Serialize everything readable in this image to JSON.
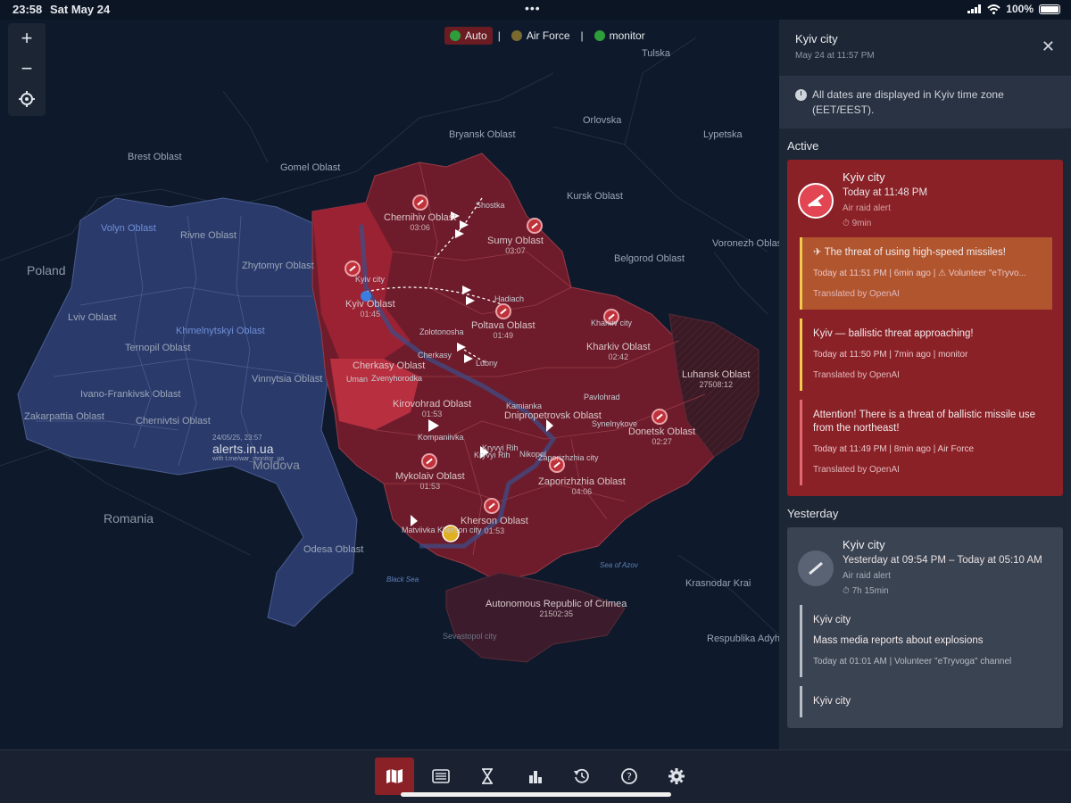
{
  "status": {
    "time": "23:58",
    "date": "Sat May 24",
    "battery": "100%"
  },
  "map": {
    "sources": [
      {
        "label": "Auto",
        "active": true,
        "color": "#2e9e3a"
      },
      {
        "label": "Air Force",
        "active": false,
        "color": "#7a6a2f"
      },
      {
        "label": "monitor",
        "active": false,
        "color": "#2e9e3a"
      }
    ],
    "countries": {
      "poland": "Poland",
      "moldova": "Moldova",
      "romania": "Romania"
    },
    "regions": {
      "brest": "Brest Oblast",
      "gomel": "Gomel Oblast",
      "bryansk": "Bryansk Oblast",
      "orlovska": "Orlovska",
      "kursk": "Kursk Oblast",
      "lypetska": "Lypetska",
      "tulska": "Tulska",
      "voronezh": "Voronezh Oblast",
      "belgorod": "Belgorod Oblast",
      "krasnodar": "Krasnodar Krai",
      "adyghea": "Respublika Adyhea",
      "volyn": "Volyn Oblast",
      "rivne": "Rivne Oblast",
      "zhytomyr": "Zhytomyr Oblast",
      "lviv": "Lviv Oblast",
      "khmelnytskyi": "Khmelnytskyi Oblast",
      "ternopil": "Ternopil Oblast",
      "vinnytsia": "Vinnytsia Oblast",
      "ivano": "Ivano-Frankivsk Oblast",
      "zakarpattia": "Zakarpattia Oblast",
      "chernivtsi": "Chernivtsi Oblast",
      "odesa": "Odesa Oblast",
      "black_sea": "Black Sea",
      "azov": "Sea of Azov",
      "sevastopol": "Sevastopol city"
    },
    "oblasts": [
      {
        "key": "chernihiv",
        "name": "Chernihiv Oblast",
        "time": "03:06"
      },
      {
        "key": "sumy",
        "name": "Sumy Oblast",
        "time": "03:07"
      },
      {
        "key": "kyiv",
        "name": "Kyiv Oblast",
        "time": "01:45"
      },
      {
        "key": "poltava",
        "name": "Poltava Oblast",
        "time": "01:49"
      },
      {
        "key": "kharkiv",
        "name": "Kharkiv Oblast",
        "time": "02:42"
      },
      {
        "key": "luhansk",
        "name": "Luhansk Oblast",
        "time": "27508:12"
      },
      {
        "key": "cherkasy",
        "name": "Cherkasy Oblast",
        "time": ""
      },
      {
        "key": "kirovohrad",
        "name": "Kirovohrad Oblast",
        "time": "01:53"
      },
      {
        "key": "dnipro",
        "name": "Dnipropetrovsk Oblast",
        "time": ""
      },
      {
        "key": "donetsk",
        "name": "Donetsk Oblast",
        "time": "02:27"
      },
      {
        "key": "mykolaiv",
        "name": "Mykolaiv Oblast",
        "time": "01:53"
      },
      {
        "key": "zaporizhzhia",
        "name": "Zaporizhzhia Oblast",
        "time": "04:06"
      },
      {
        "key": "kherson",
        "name": "Kherson Oblast",
        "time": "01:53"
      },
      {
        "key": "crimea",
        "name": "Autonomous Republic of Crimea",
        "time": "21502:35"
      }
    ],
    "cities": {
      "shostka": "Shostka",
      "kyiv_city": "Kyiv city",
      "hadiach": "Hadiach",
      "kharkiv_city": "Kharkiv city",
      "zolotonosha": "Zolotonosha",
      "cherkasy": "Cherkasy",
      "lubny": "Lubny",
      "uman": "Uman",
      "zvenyhorodka": "Zvenyhorodka",
      "kamianka": "Kamianka",
      "pavlohrad": "Pavlohrad",
      "synelnykove": "Synelnykove",
      "kropyvnytskyi": "Kompaniivka",
      "kryvyi_rih": "Kryvyi Rih",
      "kryvyi_rih2": "Kryvyi Rih",
      "nikopol": "Nikopol",
      "zaporizhzhia_city": "Zaporizhzhia city",
      "matviivka": "Matviivka",
      "kherson_city": "Kherson city"
    },
    "watermark": {
      "ts": "24/05/25, 23:57",
      "brand": "alerts.in.ua",
      "sub": "with t.me/war_monitor_ua"
    }
  },
  "panel": {
    "title": "Kyiv city",
    "subtitle": "May 24 at 11:57 PM",
    "tz_note": "All dates are displayed in Kyiv time zone (EET/EEST).",
    "active_label": "Active",
    "active": {
      "name": "Kyiv city",
      "time": "Today at 11:48 PM",
      "kind": "Air raid alert",
      "duration": "9min",
      "messages": [
        {
          "text": "The threat of using high-speed missiles!",
          "meta": "Today at 11:51 PM | 6min ago | ⚠ Volunteer \"eTryvo...",
          "tr": "Translated by OpenAI"
        },
        {
          "text": "Kyiv — ballistic threat approaching!",
          "meta": "Today at 11:50 PM | 7min ago | monitor",
          "tr": "Translated by OpenAI"
        },
        {
          "text": "Attention! There is a threat of ballistic missile use from the northeast!",
          "meta": "Today at 11:49 PM | 8min ago | Air Force",
          "tr": "Translated by OpenAI"
        }
      ]
    },
    "yesterday_label": "Yesterday",
    "yesterday": {
      "name": "Kyiv city",
      "time": "Yesterday at 09:54 PM – Today at 05:10 AM",
      "kind": "Air raid alert",
      "duration": "7h 15min",
      "messages": [
        {
          "title": "Kyiv city",
          "text": "Mass media reports about explosions",
          "meta": "Today at 01:01 AM | Volunteer \"eTryvoga\" channel"
        },
        {
          "title": "Kyiv city"
        }
      ]
    }
  },
  "toolbar": [
    {
      "key": "map",
      "icon": "map-icon",
      "active": true
    },
    {
      "key": "list",
      "icon": "list-icon",
      "active": false
    },
    {
      "key": "timer",
      "icon": "hourglass-icon",
      "active": false
    },
    {
      "key": "stats",
      "icon": "bar-chart-icon",
      "active": false
    },
    {
      "key": "history",
      "icon": "history-icon",
      "active": false
    },
    {
      "key": "help",
      "icon": "help-icon",
      "active": false
    },
    {
      "key": "settings",
      "icon": "settings-icon",
      "active": false
    }
  ]
}
